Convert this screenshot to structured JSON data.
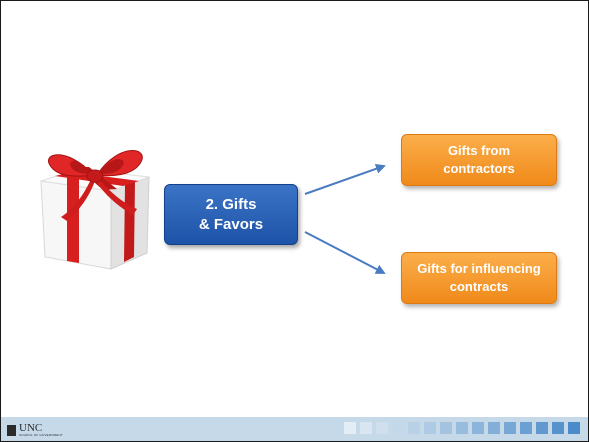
{
  "diagram": {
    "center_node": {
      "lines": [
        "2. Gifts",
        "& Favors"
      ],
      "color": "#2a5fb5"
    },
    "branches": [
      {
        "id": "top",
        "lines": [
          "Gifts from",
          "contractors"
        ],
        "color": "#f59b2f"
      },
      {
        "id": "bottom",
        "lines": [
          "Gifts for influencing",
          "contracts"
        ],
        "color": "#f59b2f"
      }
    ],
    "arrow_color": "#4a7cc1",
    "image": {
      "icon": "gift-box-icon",
      "ribbon_color": "#d81f1f"
    }
  },
  "footer": {
    "logo": {
      "name": "UNC",
      "subtitle": "SCHOOL OF GOVERNMENT"
    },
    "background": "#c5d9e9",
    "square_shades": [
      "#e3edf5",
      "#d9e6f1",
      "#cfdfed",
      "#c4d8ea",
      "#b9d1e7",
      "#aecae4",
      "#a3c3e1",
      "#98bcde",
      "#8db5db",
      "#82aed8",
      "#77a7d5",
      "#6ca0d2",
      "#6199cf",
      "#5692cc",
      "#4b8bc9"
    ]
  }
}
